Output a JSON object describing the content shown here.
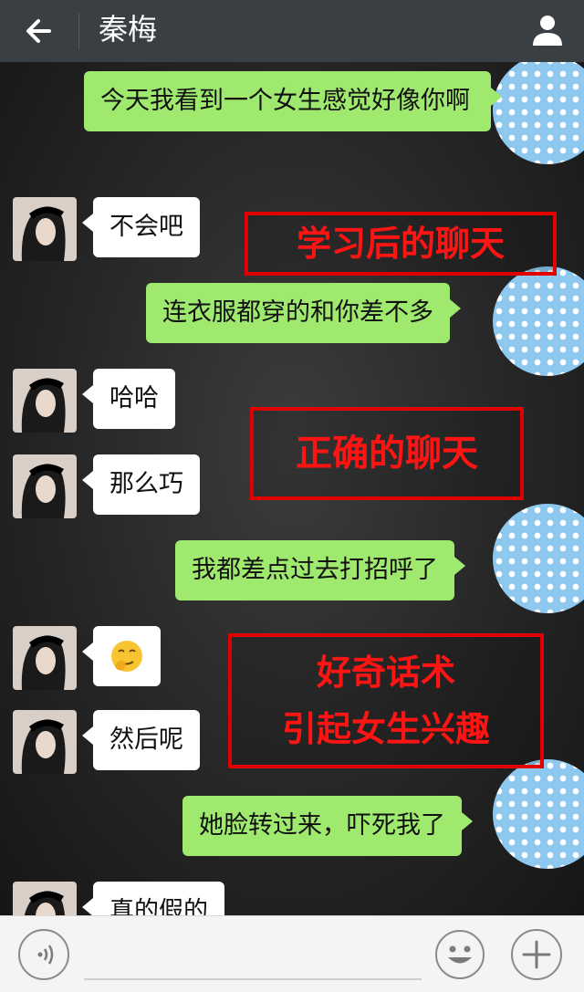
{
  "header": {
    "title": "秦梅"
  },
  "messages": [
    {
      "from": "me",
      "text": "今天我看到一个女生感觉好像你啊"
    },
    {
      "from": "them",
      "text": "不会吧"
    },
    {
      "from": "me",
      "text": "连衣服都穿的和你差不多"
    },
    {
      "from": "them",
      "text": "哈哈"
    },
    {
      "from": "them",
      "text": "那么巧"
    },
    {
      "from": "me",
      "text": "我都差点过去打招呼了"
    },
    {
      "from": "them",
      "text": "",
      "sticker": "thinking-emoji"
    },
    {
      "from": "them",
      "text": "然后呢"
    },
    {
      "from": "me",
      "text": "她脸转过来，吓死我了"
    },
    {
      "from": "them",
      "text": "真的假的"
    }
  ],
  "annotations": [
    {
      "text": "学习后的聊天"
    },
    {
      "text": "正确的聊天"
    },
    {
      "line1": "好奇话术",
      "line2": "引起女生兴趣"
    }
  ],
  "colors": {
    "accent": "#e00000",
    "my_bubble": "#9ee96e",
    "their_bubble": "#ffffff",
    "topbar": "#3a3f43"
  },
  "icons": {
    "back": "arrow-left-icon",
    "profile": "person-icon",
    "voice": "voice-icon",
    "emoji": "smiley-icon",
    "more": "plus-icon"
  }
}
